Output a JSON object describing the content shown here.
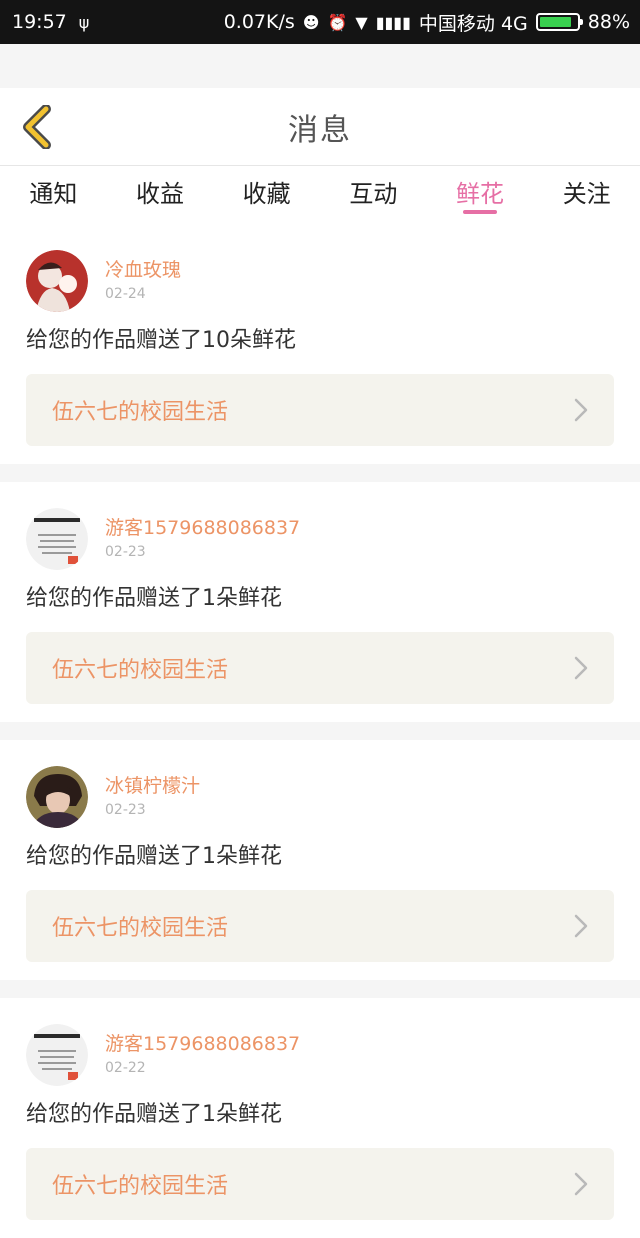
{
  "status_bar": {
    "time": "19:57",
    "network_speed": "0.07K/s",
    "carrier": "中国移动 4G",
    "battery": "88%",
    "battery_level": 0.88
  },
  "header": {
    "title": "消息",
    "back_icon": "chevron-left-icon"
  },
  "tabs": [
    {
      "label": "通知",
      "active": false
    },
    {
      "label": "收益",
      "active": false
    },
    {
      "label": "收藏",
      "active": false
    },
    {
      "label": "互动",
      "active": false
    },
    {
      "label": "鲜花",
      "active": true
    },
    {
      "label": "关注",
      "active": false
    }
  ],
  "colors": {
    "accent": "#e66fa5",
    "name": "#ec9466",
    "work_bg": "#f4f3ed"
  },
  "messages": [
    {
      "user": "冷血玫瑰",
      "date": "02-24",
      "text": "给您的作品赠送了10朵鲜花",
      "work": "伍六七的校园生活",
      "avatar": "illustration-avatar"
    },
    {
      "user": "游客1579688086837",
      "date": "02-23",
      "text": "给您的作品赠送了1朵鲜花",
      "work": "伍六七的校园生活",
      "avatar": "default-text-avatar"
    },
    {
      "user": "冰镇柠檬汁",
      "date": "02-23",
      "text": "给您的作品赠送了1朵鲜花",
      "work": "伍六七的校园生活",
      "avatar": "anime-portrait-avatar"
    },
    {
      "user": "游客1579688086837",
      "date": "02-22",
      "text": "给您的作品赠送了1朵鲜花",
      "work": "伍六七的校园生活",
      "avatar": "default-text-avatar"
    }
  ]
}
